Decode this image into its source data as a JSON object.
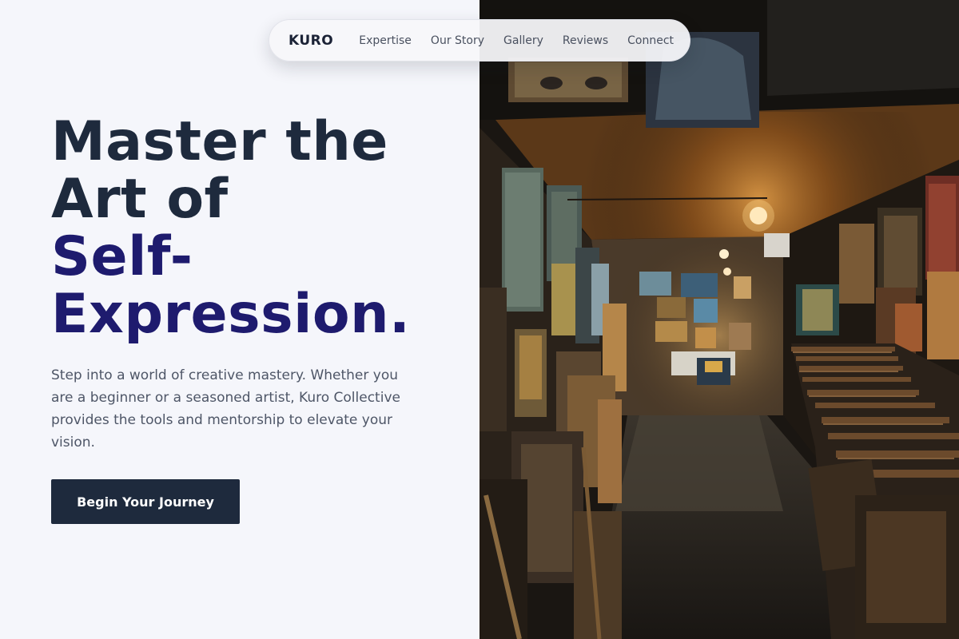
{
  "nav": {
    "logo": "KURO",
    "links": [
      "Expertise",
      "Our Story",
      "Gallery",
      "Reviews",
      "Connect"
    ]
  },
  "hero": {
    "headline_line1": "Master the",
    "headline_line2": "Art of",
    "headline_line3": "Self-",
    "headline_line4": "Expression.",
    "description": "Step into a world of creative mastery. Whether you are a beginner or a seasoned artist, Kuro Collective provides the tools and mentorship to elevate your vision.",
    "cta_label": "Begin Your Journey"
  },
  "colors": {
    "background": "#f5f6fb",
    "heading_dark": "#1e2a3d",
    "heading_accent": "#1e1b6e",
    "body_text": "#4e5667",
    "button_bg": "#1e2a3d",
    "button_text": "#ffffff"
  },
  "image": {
    "subject": "art-shop-aisle-photo"
  }
}
